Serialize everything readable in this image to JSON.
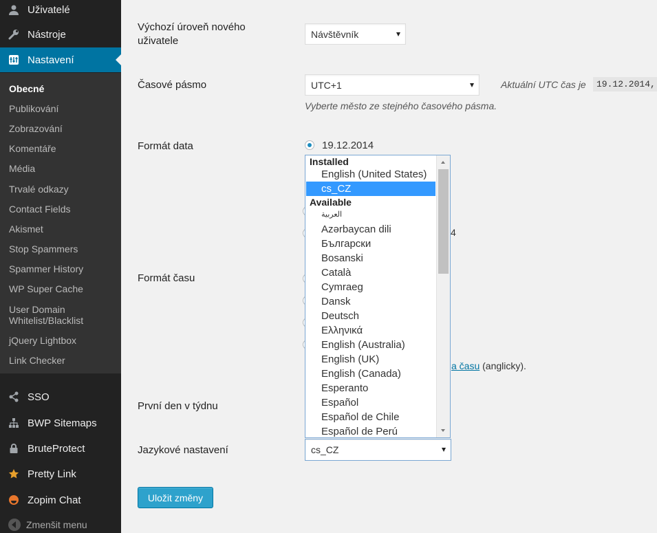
{
  "sidebar": {
    "top_items": [
      {
        "label": "Uživatelé",
        "icon": "user-icon"
      },
      {
        "label": "Nástroje",
        "icon": "wrench-icon"
      },
      {
        "label": "Nastavení",
        "icon": "settings-icon"
      }
    ],
    "submenu": [
      "Obecné",
      "Publikování",
      "Zobrazování",
      "Komentáře",
      "Média",
      "Trvalé odkazy",
      "Contact Fields",
      "Akismet",
      "Stop Spammers",
      "Spammer History",
      "WP Super Cache",
      "User Domain Whitelist/Blacklist",
      "jQuery Lightbox",
      "Link Checker"
    ],
    "plugin_items": [
      {
        "label": "SSO",
        "icon": "share-icon"
      },
      {
        "label": "BWP Sitemaps",
        "icon": "sitemap-icon"
      },
      {
        "label": "BruteProtect",
        "icon": "lock-icon"
      },
      {
        "label": "Pretty Link",
        "icon": "star-icon"
      },
      {
        "label": "Zopim Chat",
        "icon": "chat-icon"
      }
    ],
    "collapse_label": "Zmenšit menu"
  },
  "settings": {
    "default_role_label": "Výchozí úroveň nového uživatele",
    "default_role_value": "Návštěvník",
    "timezone_label": "Časové pásmo",
    "timezone_value": "UTC+1",
    "utc_time_label": "Aktuální UTC čas je",
    "utc_time_value": "19.12.2014,",
    "timezone_desc": "Vyberte město ze stejného časového pásma.",
    "date_format_label": "Formát data",
    "date_format_option": "19.12.2014",
    "time_format_label": "Formát času",
    "time_doc_link": "a času",
    "time_doc_suffix": "(anglicky).",
    "partial_char": "4",
    "week_start_label": "První den v týdnu",
    "language_label": "Jazykové nastavení",
    "language_value": "cs_CZ",
    "save_button": "Uložit změny"
  },
  "dropdown": {
    "group_installed": "Installed",
    "installed": [
      "English (United States)",
      "cs_CZ"
    ],
    "group_available": "Available",
    "available": [
      "العربية",
      "Azərbaycan dili",
      "Български",
      "Bosanski",
      "Català",
      "Cymraeg",
      "Dansk",
      "Deutsch",
      "Ελληνικά",
      "English (Australia)",
      "English (UK)",
      "English (Canada)",
      "Esperanto",
      "Español",
      "Español de Chile",
      "Español de Perú"
    ]
  }
}
